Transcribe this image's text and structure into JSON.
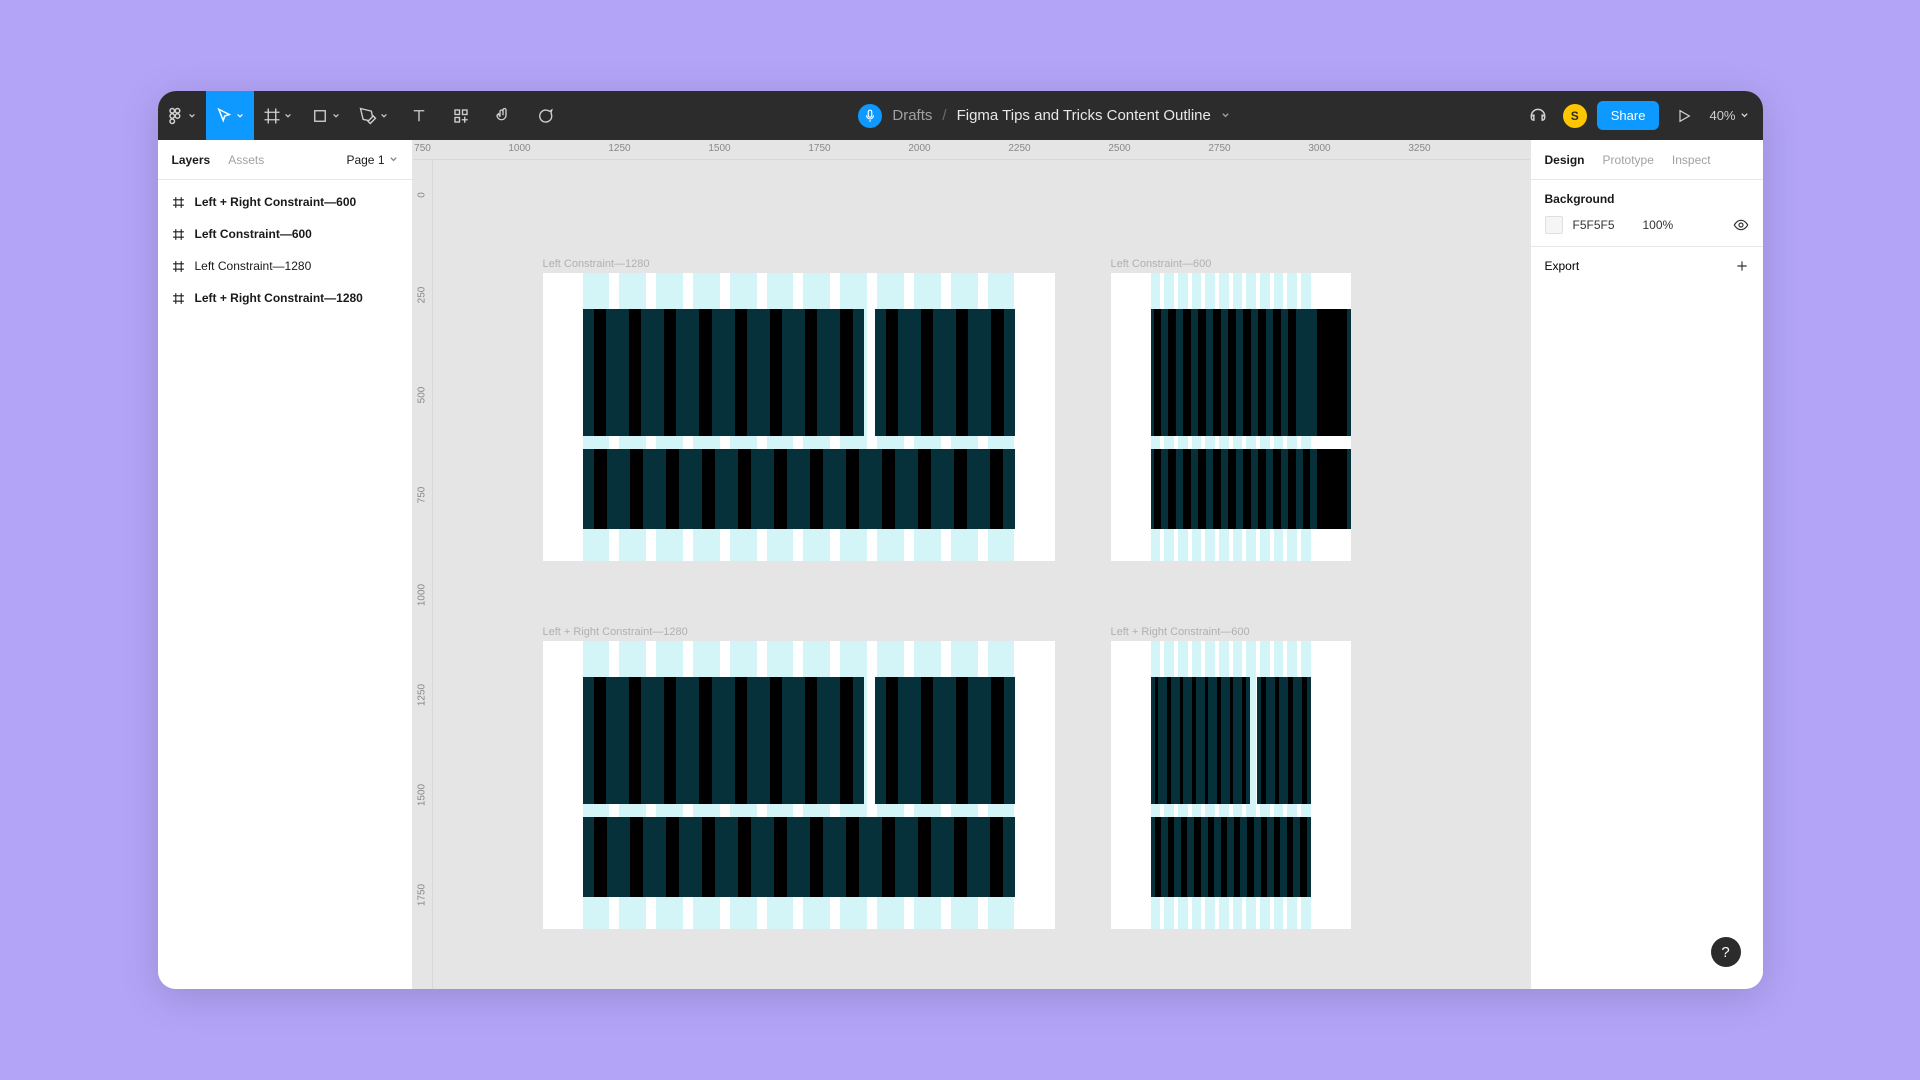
{
  "toolbar": {
    "breadcrumb_parent": "Drafts",
    "breadcrumb_slash": "/",
    "file_name": "Figma Tips and Tricks Content Outline",
    "share_label": "Share",
    "zoom": "40%",
    "avatar_letter": "S"
  },
  "left_panel": {
    "tabs": {
      "layers": "Layers",
      "assets": "Assets"
    },
    "page_label": "Page 1",
    "layers": [
      {
        "name": "Left + Right Constraint—600",
        "bold": true
      },
      {
        "name": "Left Constraint—600",
        "bold": true
      },
      {
        "name": "Left Constraint—1280",
        "bold": false
      },
      {
        "name": "Left + Right Constraint—1280",
        "bold": true
      }
    ]
  },
  "ruler_h": [
    "750",
    "1000",
    "1250",
    "1500",
    "1750",
    "2000",
    "2250",
    "2500",
    "2750",
    "3000",
    "3250"
  ],
  "ruler_v": [
    "0",
    "250",
    "500",
    "750",
    "1000",
    "1250",
    "1500",
    "1750"
  ],
  "canvas": {
    "frames": [
      {
        "label": "Left Constraint—1280"
      },
      {
        "label": "Left Constraint—600"
      },
      {
        "label": "Left + Right Constraint—1280"
      },
      {
        "label": "Left + Right Constraint—600"
      }
    ]
  },
  "right_panel": {
    "tabs": {
      "design": "Design",
      "prototype": "Prototype",
      "inspect": "Inspect"
    },
    "background_label": "Background",
    "background_hex": "F5F5F5",
    "background_opacity": "100%",
    "export_label": "Export"
  },
  "help": "?"
}
